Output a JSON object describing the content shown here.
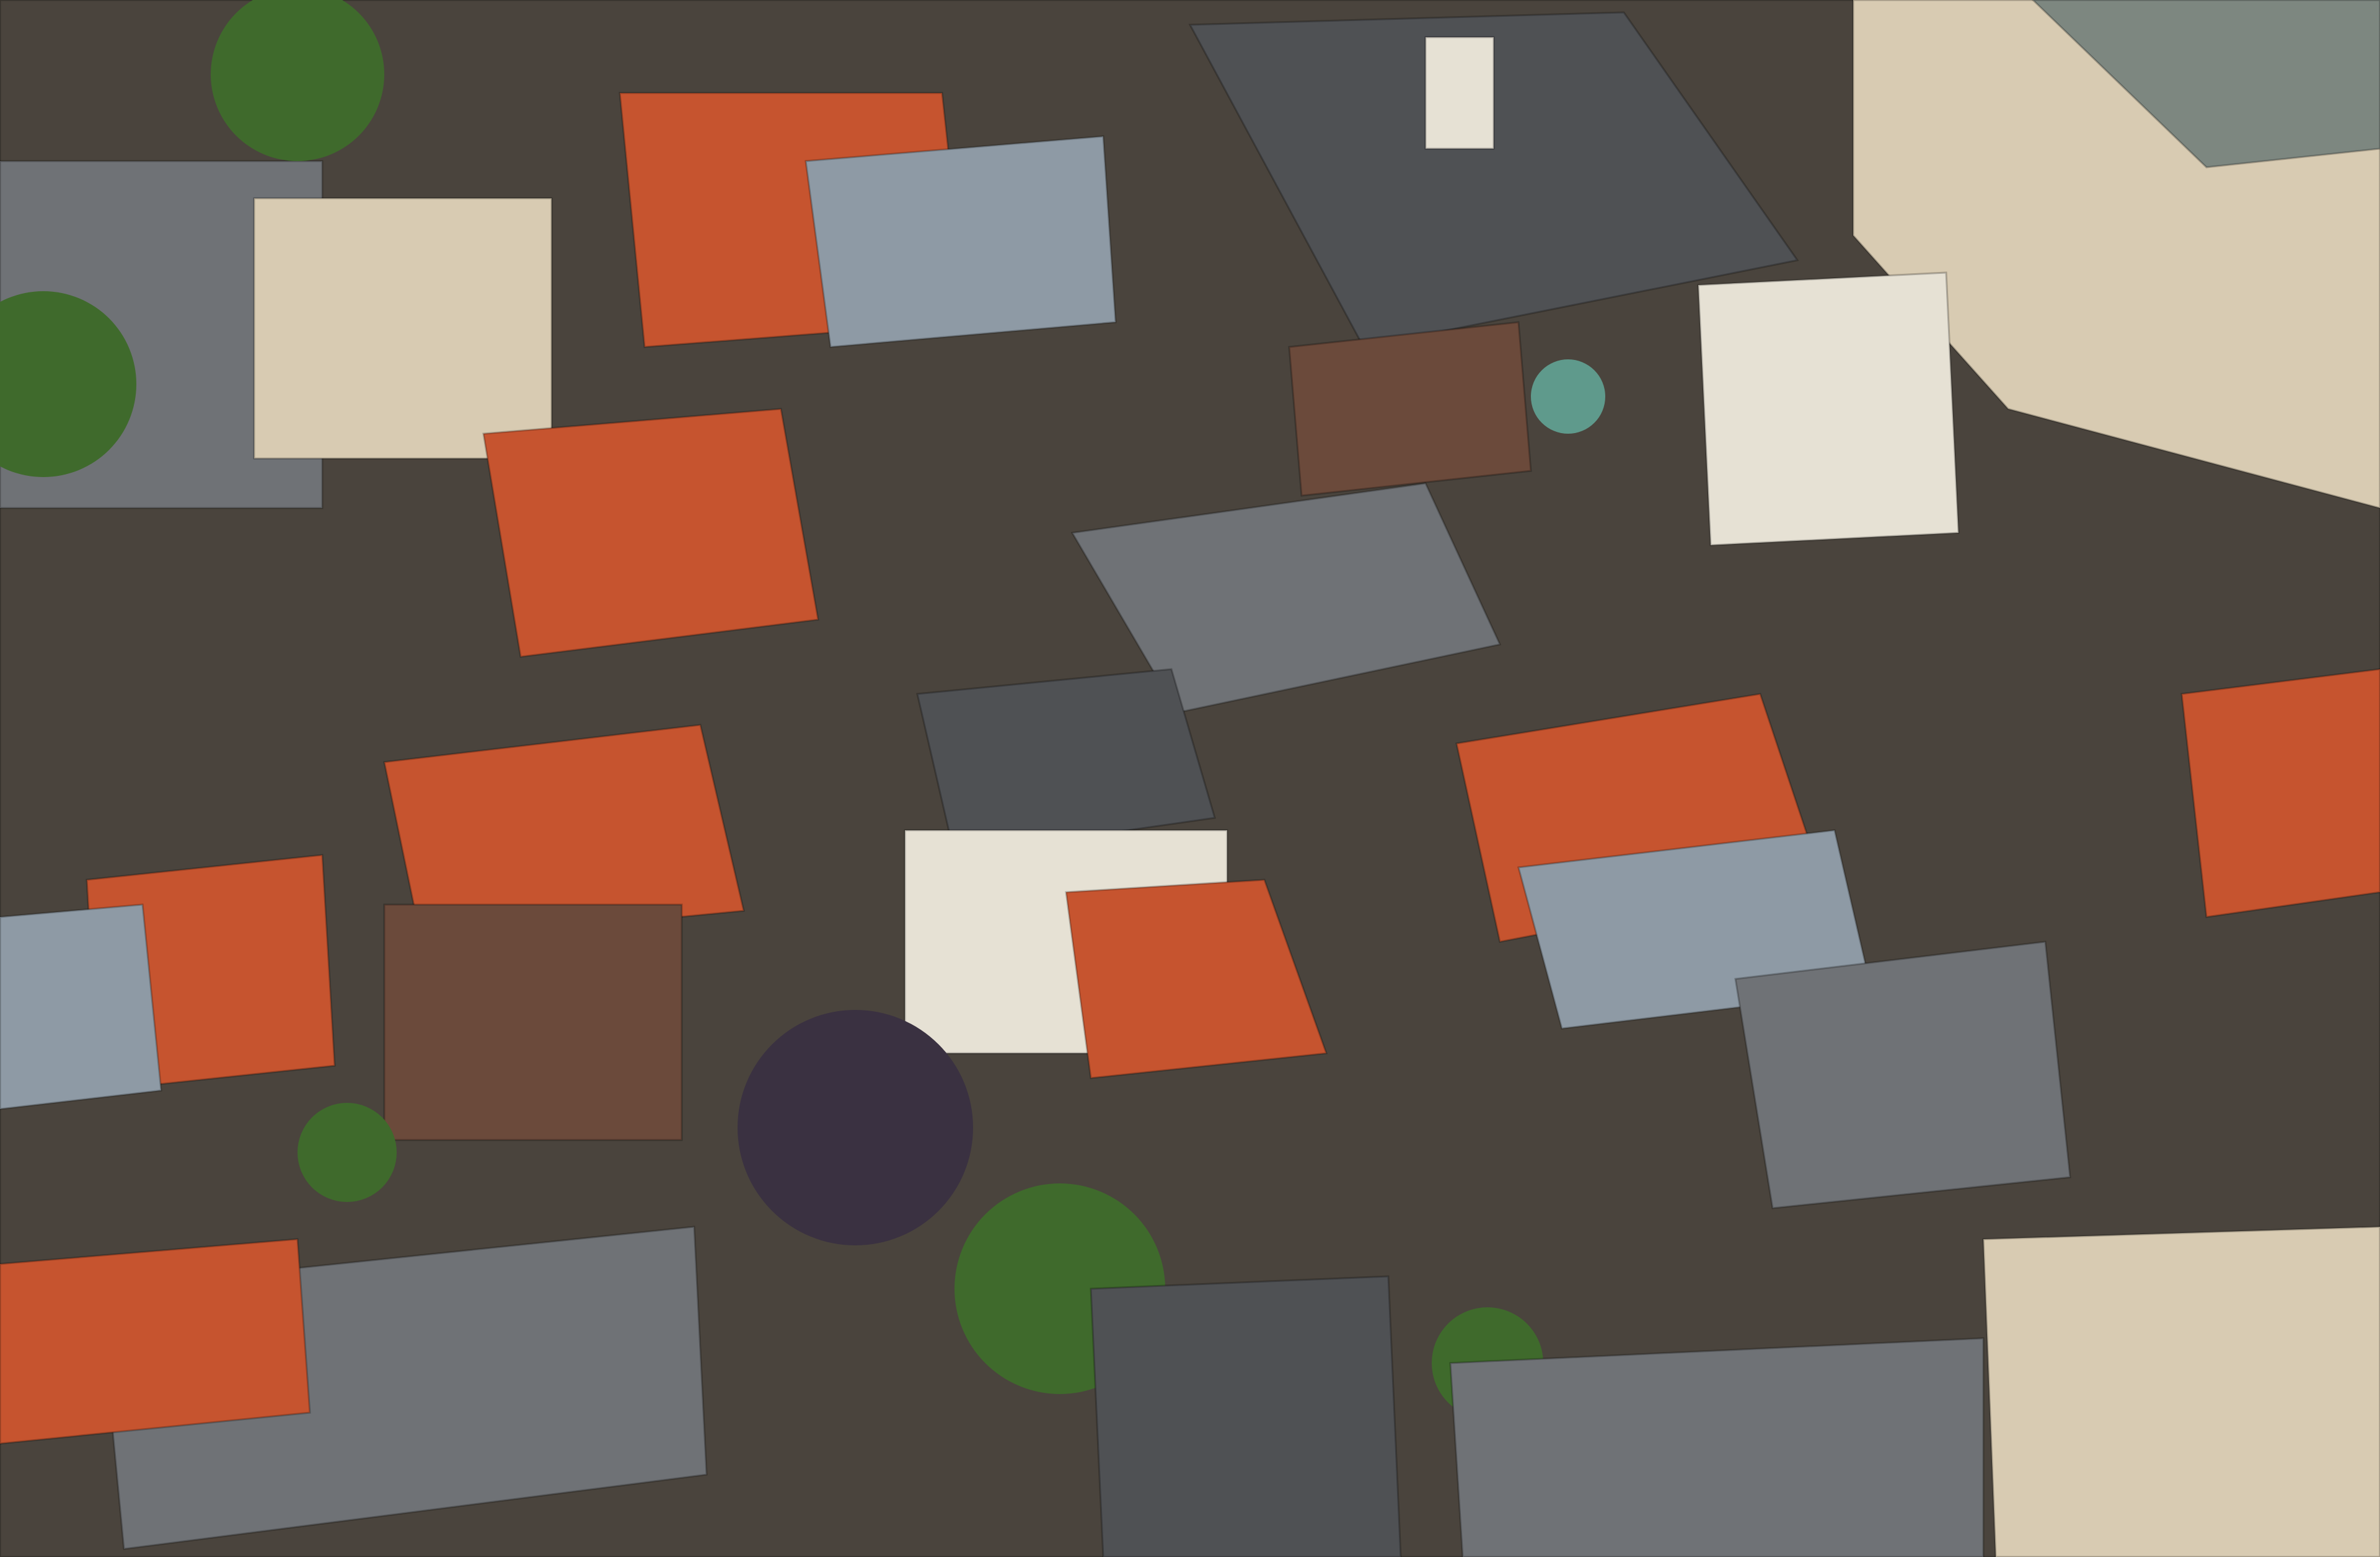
{
  "image": {
    "kind": "aerial-photograph",
    "visible_text": [],
    "palette": {
      "ground": "#4a443d",
      "slate_roof": "#6f7276",
      "dark_roof": "#4f5154",
      "blue_gray_roof": "#8e9aa5",
      "orange_tile_roof": "#c6542f",
      "light_facade": "#e6e1d4",
      "brick_facade": "#6b4a3b",
      "beige_facade": "#d8cbb2",
      "tree": "#3f6a2c",
      "dark_tree": "#3a3141",
      "copper_dome": "#5f9a8c"
    }
  }
}
